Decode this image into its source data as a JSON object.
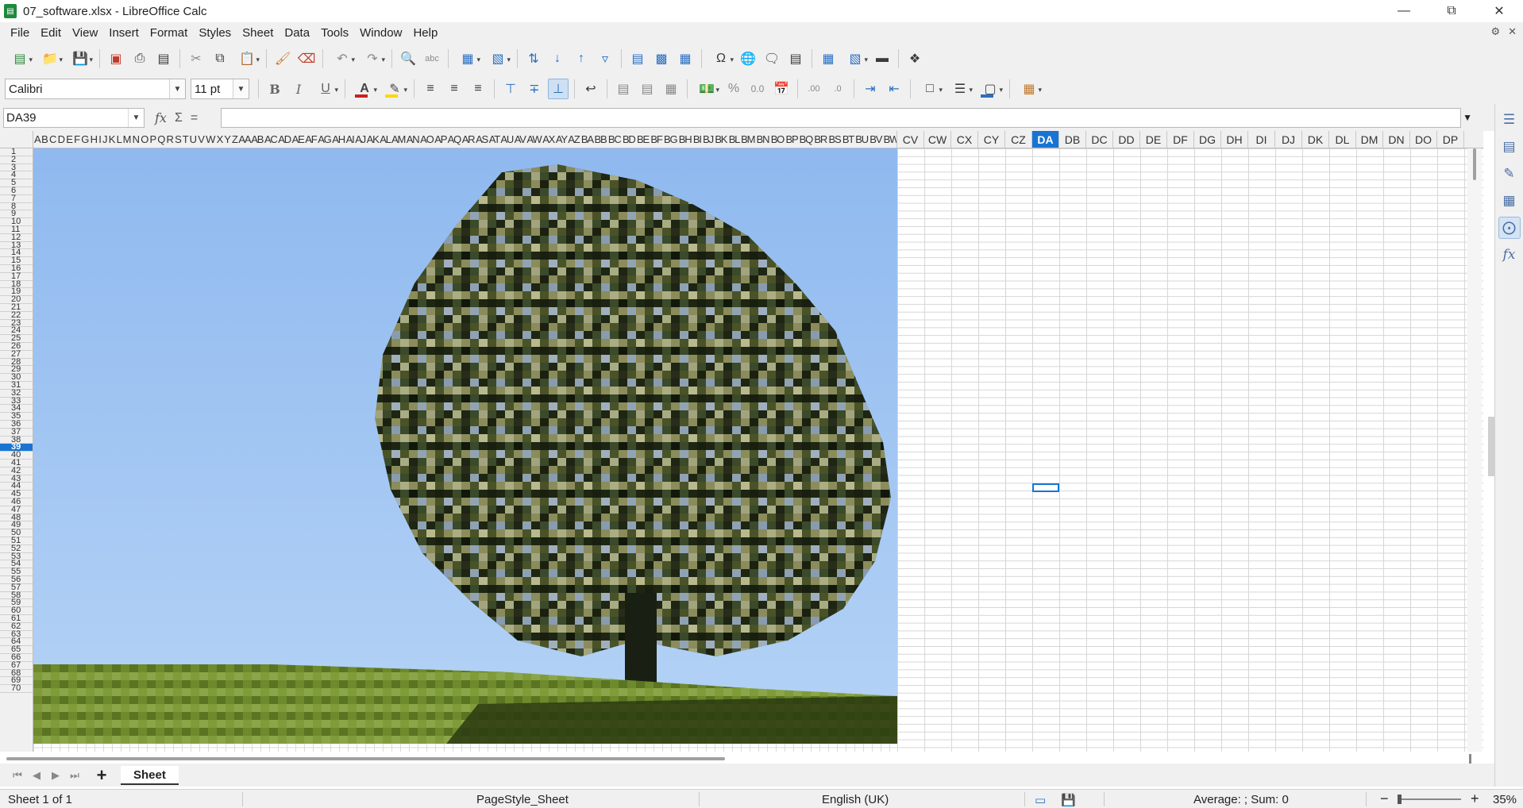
{
  "window": {
    "title": "07_software.xlsx - LibreOffice Calc",
    "app_icon": "calc-icon",
    "controls": [
      "minimize",
      "restore",
      "close"
    ]
  },
  "menu": {
    "items": [
      "File",
      "Edit",
      "View",
      "Insert",
      "Format",
      "Styles",
      "Sheet",
      "Data",
      "Tools",
      "Window",
      "Help"
    ]
  },
  "formatting": {
    "font_name": "Calibri",
    "font_size": "11 pt",
    "bold_label": "B",
    "italic_label": "I",
    "underline_label": "U",
    "percent_label": "%",
    "decimals_label": "0.0",
    "font_color": "#c9211e",
    "highlight_color": "#ffd700",
    "border_color": "#2a6fc2"
  },
  "formula": {
    "cell_reference": "DA39",
    "content": "",
    "fx_label": "fx",
    "sum_label": "Σ",
    "equals_label": "="
  },
  "columns": {
    "narrow_labels_text": "A B C D E F G H I J K L M N O P Q R S T U V W X Y Z AA AB AC AD AE AF AG AH AI AJ AK AL AM AN AO AP AQ AR AS AT AU AV AW AX AY AZ BA BB BC BD BE BF BG BH BI BJ BK BL BM BN BO BP BQ BR BS BT BU BV BW BX BY BZ CA CB CC CD CE CF CG CH CI CJ CK CL CM CN CO CP CQ CR CS CT CU",
    "wide_labels": [
      "CV",
      "CW",
      "CX",
      "CY",
      "CZ",
      "DA",
      "DB",
      "DC",
      "DD",
      "DE",
      "DF",
      "DG",
      "DH",
      "DI",
      "DJ",
      "DK",
      "DL",
      "DM",
      "DN",
      "DO",
      "DP"
    ],
    "selected": "DA"
  },
  "rows": {
    "first": 1,
    "last": 70,
    "selected": 39
  },
  "picture": {
    "description_colors": {
      "sky": "#8fb9ef",
      "foliage_dark": "#2b3318",
      "foliage_light": "#b8b98a",
      "trunk": "#1a1f14",
      "grass": "#6d8a2c",
      "grass_dark": "#2a3a10"
    }
  },
  "sheets": {
    "tabs": [
      "Sheet"
    ],
    "active": "Sheet"
  },
  "status": {
    "sheet_position": "Sheet 1 of 1",
    "page_style": "PageStyle_Sheet",
    "language": "English (UK)",
    "selection_stats": "Average: ; Sum: 0",
    "zoom": "35%",
    "zoom_minus": "−",
    "zoom_plus": "+"
  }
}
